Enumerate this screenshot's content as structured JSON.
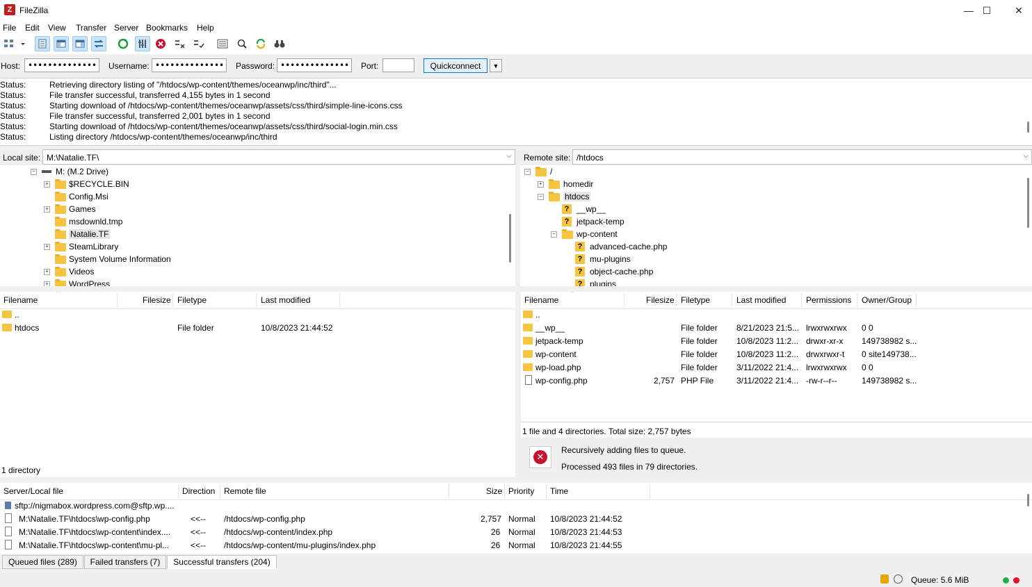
{
  "window": {
    "title": "FileZilla",
    "controls": {
      "minimize": "—",
      "maximize": "☐",
      "close": "✕"
    }
  },
  "menu": [
    "File",
    "Edit",
    "View",
    "Transfer",
    "Server",
    "Bookmarks",
    "Help"
  ],
  "quickconnect": {
    "host_label": "Host:",
    "host_value": "••••••••••••••",
    "username_label": "Username:",
    "username_value": "••••••••••••••",
    "password_label": "Password:",
    "password_value": "••••••••••••••",
    "port_label": "Port:",
    "port_value": "",
    "button": "Quickconnect"
  },
  "log": [
    {
      "k": "Status:",
      "v": "Retrieving directory listing of \"/htdocs/wp-content/themes/oceanwp/inc/third\"..."
    },
    {
      "k": "Status:",
      "v": "File transfer successful, transferred 4,155 bytes in 1 second"
    },
    {
      "k": "Status:",
      "v": "Starting download of /htdocs/wp-content/themes/oceanwp/assets/css/third/simple-line-icons.css"
    },
    {
      "k": "Status:",
      "v": "File transfer successful, transferred 2,001 bytes in 1 second"
    },
    {
      "k": "Status:",
      "v": "Starting download of /htdocs/wp-content/themes/oceanwp/assets/css/third/social-login.min.css"
    },
    {
      "k": "Status:",
      "v": "Listing directory /htdocs/wp-content/themes/oceanwp/inc/third"
    }
  ],
  "local": {
    "site_label": "Local site:",
    "site_path": "M:\\Natalie.TF\\",
    "tree": [
      "M: (M.2 Drive)",
      "$RECYCLE.BIN",
      "Config.Msi",
      "Games",
      "msdownld.tmp",
      "Natalie.TF",
      "SteamLibrary",
      "System Volume Information",
      "Videos",
      "WordPress"
    ],
    "columns": [
      "Filename",
      "Filesize",
      "Filetype",
      "Last modified"
    ],
    "files": [
      {
        "name": "..",
        "size": "",
        "type": "",
        "modified": ""
      },
      {
        "name": "htdocs",
        "size": "",
        "type": "File folder",
        "modified": "10/8/2023 21:44:52"
      }
    ],
    "status": "1 directory"
  },
  "remote": {
    "site_label": "Remote site:",
    "site_path": "/htdocs",
    "tree": [
      "/",
      "homedir",
      "htdocs",
      "__wp__",
      "jetpack-temp",
      "wp-content",
      "advanced-cache.php",
      "mu-plugins",
      "object-cache.php",
      "plugins"
    ],
    "columns": [
      "Filename",
      "Filesize",
      "Filetype",
      "Last modified",
      "Permissions",
      "Owner/Group"
    ],
    "files": [
      {
        "name": "..",
        "size": "",
        "type": "",
        "modified": "",
        "perm": "",
        "owner": ""
      },
      {
        "name": "__wp__",
        "size": "",
        "type": "File folder",
        "modified": "8/21/2023 21:5...",
        "perm": "lrwxrwxrwx",
        "owner": "0 0"
      },
      {
        "name": "jetpack-temp",
        "size": "",
        "type": "File folder",
        "modified": "10/8/2023 11:2...",
        "perm": "drwxr-xr-x",
        "owner": "149738982 s..."
      },
      {
        "name": "wp-content",
        "size": "",
        "type": "File folder",
        "modified": "10/8/2023 11:2...",
        "perm": "drwxrwxr-t",
        "owner": "0 site149738..."
      },
      {
        "name": "wp-load.php",
        "size": "",
        "type": "File folder",
        "modified": "3/11/2022 21:4...",
        "perm": "lrwxrwxrwx",
        "owner": "0 0"
      },
      {
        "name": "wp-config.php",
        "size": "2,757",
        "type": "PHP File",
        "modified": "3/11/2022 21:4...",
        "perm": "-rw-r--r--",
        "owner": "149738982 s..."
      }
    ],
    "status": "1 file and 4 directories. Total size: 2,757 bytes"
  },
  "notification": {
    "line1": "Recursively adding files to queue.",
    "line2": "Processed 493 files in 79 directories."
  },
  "queue": {
    "columns": [
      "Server/Local file",
      "Direction",
      "Remote file",
      "Size",
      "Priority",
      "Time"
    ],
    "server": "sftp://nigmabox.wordpress.com@sftp.wp....",
    "rows": [
      {
        "local": "M:\\Natalie.TF\\htdocs\\wp-config.php",
        "dir": "<<--",
        "remote": "/htdocs/wp-config.php",
        "size": "2,757",
        "prio": "Normal",
        "time": "10/8/2023 21:44:52"
      },
      {
        "local": "M:\\Natalie.TF\\htdocs\\wp-content\\index....",
        "dir": "<<--",
        "remote": "/htdocs/wp-content/index.php",
        "size": "26",
        "prio": "Normal",
        "time": "10/8/2023 21:44:53"
      },
      {
        "local": "M:\\Natalie.TF\\htdocs\\wp-content\\mu-pl...",
        "dir": "<<--",
        "remote": "/htdocs/wp-content/mu-plugins/index.php",
        "size": "26",
        "prio": "Normal",
        "time": "10/8/2023 21:44:55"
      }
    ],
    "tabs": [
      "Queued files (289)",
      "Failed transfers (7)",
      "Successful transfers (204)"
    ]
  },
  "statusbar": {
    "queue": "Queue: 5.6 MiB"
  },
  "colors": {
    "accent": "#0078d7",
    "folder": "#f5c542",
    "error": "#c8102e",
    "led_green": "#22b14c",
    "led_red": "#e81123"
  }
}
